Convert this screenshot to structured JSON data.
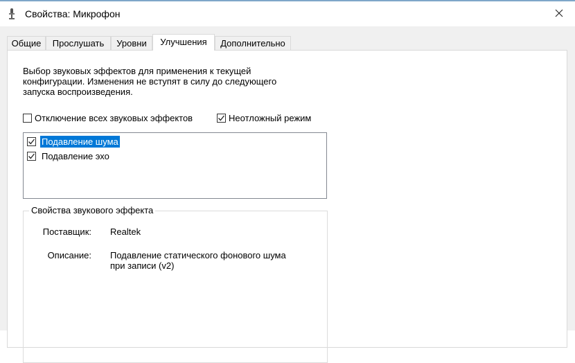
{
  "window": {
    "title": "Свойства: Микрофон"
  },
  "tabs": [
    {
      "label": "Общие",
      "active": false
    },
    {
      "label": "Прослушать",
      "active": false
    },
    {
      "label": "Уровни",
      "active": false
    },
    {
      "label": "Улучшения",
      "active": true
    },
    {
      "label": "Дополнительно",
      "active": false
    }
  ],
  "enhancements": {
    "description_lines": [
      "Выбор звуковых эффектов для применения к текущей",
      "конфигурации. Изменения не вступят в силу до следующего",
      "запуска воспроизведения."
    ],
    "disable_all": {
      "label": "Отключение всех звуковых эффектов",
      "checked": false
    },
    "immediate_mode": {
      "label": "Неотложный режим",
      "checked": true
    },
    "effects": [
      {
        "label": "Подавление шума",
        "checked": true,
        "selected": true
      },
      {
        "label": "Подавление эхо",
        "checked": true,
        "selected": false
      }
    ],
    "properties": {
      "group_title": "Свойства звукового эффекта",
      "provider_label": "Поставщик:",
      "provider_value": "Realtek",
      "description_label": "Описание:",
      "description_lines": [
        "Подавление статического фонового шума",
        "при записи (v2)"
      ]
    }
  },
  "icons": {
    "app": "microphone-icon",
    "close": "close-icon",
    "check": "checkmark-icon"
  },
  "colors": {
    "selection": "#0078d7",
    "dialog_bg": "#f0f0f0",
    "title_accent": "#7fa7c9"
  }
}
